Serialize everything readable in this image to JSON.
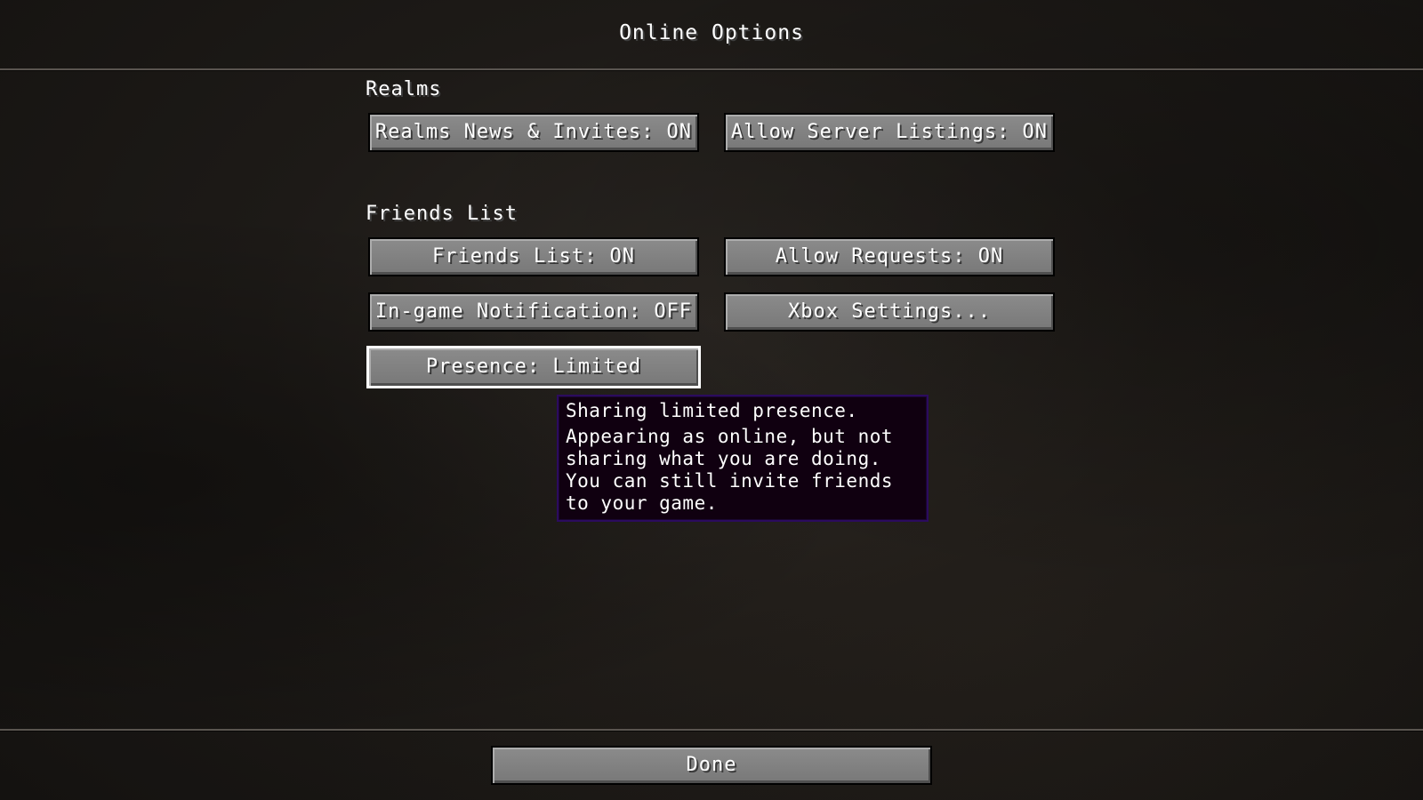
{
  "screen": {
    "title": "Online Options"
  },
  "sections": {
    "realms": {
      "label": "Realms",
      "news_invites_button": "Realms News & Invites: ON",
      "server_listings_button": "Allow Server Listings: ON"
    },
    "friends": {
      "label": "Friends List",
      "friends_list_button": "Friends List: ON",
      "allow_requests_button": "Allow Requests: ON",
      "ingame_notification_button": "In-game Notification: OFF",
      "xbox_settings_button": "Xbox Settings...",
      "presence_button": "Presence: Limited"
    }
  },
  "tooltip": {
    "heading": "Sharing limited presence.",
    "body": "Appearing as online, but not sharing what you are doing. You can still invite friends to your game."
  },
  "footer": {
    "done_button": "Done"
  },
  "colors": {
    "button_face": "#8b8b8b",
    "button_border": "#000000",
    "selected_border": "#ffffff",
    "tooltip_bg": "#100010",
    "tooltip_border": "#2b0b5e"
  }
}
